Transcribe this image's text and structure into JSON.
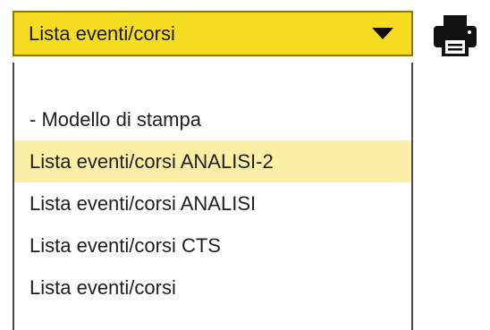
{
  "select": {
    "value": "Lista eventi/corsi",
    "dropdown_icon": "caret-down-icon",
    "accent_color": "#f7dd22"
  },
  "print_button": {
    "icon": "printer-icon"
  },
  "options": [
    {
      "label": "- Modello di stampa",
      "selected": false
    },
    {
      "label": "Lista eventi/corsi ANALISI-2",
      "selected": true
    },
    {
      "label": "Lista eventi/corsi ANALISI",
      "selected": false
    },
    {
      "label": "Lista eventi/corsi CTS",
      "selected": false
    },
    {
      "label": "Lista eventi/corsi",
      "selected": false
    }
  ],
  "highlight_color": "#fbeea5"
}
